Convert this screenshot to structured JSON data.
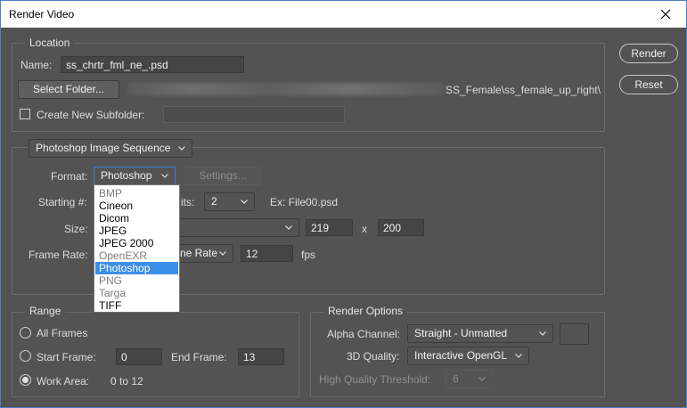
{
  "window": {
    "title": "Render Video"
  },
  "buttons": {
    "render": "Render",
    "reset": "Reset"
  },
  "location": {
    "legend": "Location",
    "name_label": "Name:",
    "name_value": "ss_chrtr_fml_ne_.psd",
    "select_folder": "Select Folder...",
    "folder_path_visible": "SS_Female\\ss_female_up_right\\",
    "create_subfolder_label": "Create New Subfolder:",
    "create_subfolder_checked": false,
    "subfolder_value": ""
  },
  "sequence": {
    "type_select": "Photoshop Image Sequence",
    "format_label": "Format:",
    "format_value": "Photoshop",
    "settings_button": "Settings...",
    "starting_label": "Starting #:",
    "digits_label": "its:",
    "digits_value": "2",
    "example": "Ex: File00.psd",
    "size_label": "Size:",
    "width": "219",
    "x_label": "x",
    "height": "200",
    "frame_rate_label": "Frame Rate:",
    "frame_rate_select": "ne Rate",
    "fps_value": "12",
    "fps_label": "fps"
  },
  "format_dropdown": {
    "items": [
      {
        "label": "BMP",
        "state": "grey"
      },
      {
        "label": "Cineon",
        "state": "normal"
      },
      {
        "label": "Dicom",
        "state": "normal"
      },
      {
        "label": "JPEG",
        "state": "normal"
      },
      {
        "label": "JPEG 2000",
        "state": "normal"
      },
      {
        "label": "OpenEXR",
        "state": "grey"
      },
      {
        "label": "Photoshop",
        "state": "selected"
      },
      {
        "label": "PNG",
        "state": "grey"
      },
      {
        "label": "Targa",
        "state": "grey"
      },
      {
        "label": "TIFF",
        "state": "normal"
      }
    ]
  },
  "range": {
    "legend": "Range",
    "all_frames": "All Frames",
    "start_frame_label": "Start Frame:",
    "start_frame_value": "0",
    "end_frame_label": "End Frame:",
    "end_frame_value": "13",
    "work_area_label": "Work Area:",
    "work_area_value": "0 to 12",
    "selected": "work_area"
  },
  "render_options": {
    "legend": "Render Options",
    "alpha_label": "Alpha Channel:",
    "alpha_value": "Straight - Unmatted",
    "quality_label": "3D Quality:",
    "quality_value": "Interactive OpenGL",
    "threshold_label": "High Quality Threshold:",
    "threshold_value": "6"
  },
  "colors": {
    "dialog_bg": "#535353",
    "selection": "#3c8fe6",
    "frame": "#4f7fbf"
  }
}
